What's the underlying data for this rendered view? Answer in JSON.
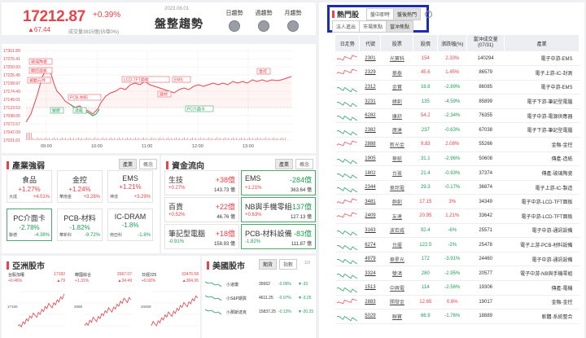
{
  "header": {
    "price": "17212.87",
    "pct": "+0.39%",
    "change": "▲67.44",
    "volume": "成交量3815億(佔增0%)",
    "date": "2023.08.01",
    "trend": "盤整趨勢",
    "buttons": [
      "日趨勢",
      "週趨勢",
      "月趨勢"
    ]
  },
  "intraday": {
    "y_ticks": [
      "17301.89",
      "17276.41",
      "17250.93",
      "17225.45",
      "17199.97",
      "17174.49",
      "17149.01",
      "17123.53",
      "17098.05",
      "17072.57",
      "17047.09",
      "17021.61"
    ],
    "x_ticks": [
      "09:00",
      "10:00",
      "11:00",
      "12:00",
      "13:00"
    ],
    "annotations": [
      "玻璃陶瓷",
      "觸控面板",
      "LCD-TFT面板",
      "EMS",
      "金控",
      "被動元件",
      "PCB-材料",
      "建材",
      "PC介面卡",
      "造紙",
      "塑膠"
    ],
    "prev_close": 17145.43
  },
  "sectors": {
    "title": "產業強弱",
    "tabs": [
      "產業",
      "概念"
    ],
    "cards": [
      {
        "name": "食品",
        "pct": "+1.27%",
        "sub": "大成",
        "subpct": "+4.01%"
      },
      {
        "name": "金控",
        "pct": "+1.24%",
        "sub": "華南金",
        "subpct": "+3.28%"
      },
      {
        "name": "EMS",
        "pct": "+1.21%",
        "sub": "神達",
        "subpct": "+3.29%"
      },
      {
        "name": "PC介面卡",
        "pct": "-2.78%",
        "sub": "聯德",
        "subpct": "-4.38%"
      },
      {
        "name": "PCB-材料",
        "pct": "-1.82%",
        "sub": "華新科",
        "subpct": "-9.72%"
      },
      {
        "name": "IC-DRAM",
        "pct": "-1.8%",
        "sub": "南亞科",
        "subpct": "-1.8%"
      }
    ]
  },
  "fund_flow": {
    "title": "資金流向",
    "tabs": [
      "產業",
      "概念"
    ],
    "cards": [
      {
        "name": "生技",
        "value": "+38億",
        "pct": "+0.27%",
        "amount": "143.73 億"
      },
      {
        "name": "EMS",
        "value": "-284億",
        "pct": "+1.21%",
        "amount": "363.64 億"
      },
      {
        "name": "百貨",
        "value": "+22億",
        "pct": "+0.52%",
        "amount": "46.76 億"
      },
      {
        "name": "NB與手機零組",
        "value": "-137億",
        "pct": "+0.63%",
        "amount": "127.13 億"
      },
      {
        "name": "筆記型電腦",
        "value": "+18億",
        "pct": "-0.91%",
        "amount": "158.93 億"
      },
      {
        "name": "PCB-材料設備",
        "value": "-83億",
        "pct": "-1.82%",
        "amount": "111.87 億"
      }
    ]
  },
  "asia": {
    "title": "亞洲股市",
    "minis": [
      {
        "name": "台股加權",
        "value": "17182",
        "pct": "+0.46%",
        "chg": "▲79"
      },
      {
        "name": "韓國綜合",
        "value": "2667.07",
        "pct": "+1.31%",
        "chg": "▲34.49"
      },
      {
        "name": "日經225",
        "value": "33476.58",
        "pct": "+0.92%",
        "chg": "▲304.36"
      }
    ],
    "mini_ticks": [
      "17160",
      "2668",
      "33469"
    ]
  },
  "us": {
    "title": "美國股市",
    "tabs": [
      "期貨",
      "指數"
    ],
    "page": "1/3",
    "rows": [
      {
        "name": "小道瓊",
        "value": "35662",
        "pct": "-0.09%",
        "chg": "▼-33"
      },
      {
        "name": "小S&P期貨",
        "value": "4611.25",
        "pct": "-0.07%",
        "chg": "▼-3.25"
      },
      {
        "name": "小那斯達克",
        "value": "15837.25",
        "pct": "-0.13%",
        "chg": "▼-20.25"
      }
    ]
  },
  "hot": {
    "title": "熱門股",
    "tabs1": [
      "盤中即時",
      "盤後熱門"
    ],
    "tabs2": [
      "法人進出",
      "市場焦點",
      "當沖焦點"
    ],
    "help": "?",
    "columns": [
      "日走勢",
      "代號",
      "股票",
      "股價",
      "漲跌幅(%)",
      "當沖成交量\n(07/31)",
      "產業"
    ],
    "rows": [
      {
        "code": "2301",
        "name": "光寶科",
        "price": "154",
        "pct": "2.33%",
        "vol": "140294",
        "ind": "電子中游-EMS",
        "up": true
      },
      {
        "code": "2329",
        "name": "華泰",
        "price": "45.6",
        "pct": "1.45%",
        "vol": "86579",
        "ind": "電子上游-IC-封測",
        "up": true
      },
      {
        "code": "2312",
        "name": "金寶",
        "price": "16.8",
        "pct": "-2.89%",
        "vol": "86085",
        "ind": "電子中游-EMS",
        "up": false
      },
      {
        "code": "3231",
        "name": "緯創",
        "price": "135",
        "pct": "-4.59%",
        "vol": "85899",
        "ind": "電子下游-筆記型電腦",
        "up": false
      },
      {
        "code": "6282",
        "name": "康舒",
        "price": "54.2",
        "price_up": true,
        "pct": "-2.34%",
        "vol": "76355",
        "ind": "電子中游-電源供應器",
        "up": false
      },
      {
        "code": "2382",
        "name": "廣達",
        "price": "237",
        "pct": "-0.63%",
        "vol": "67038",
        "ind": "電子下游-筆記型電腦",
        "up": false
      },
      {
        "code": "2888",
        "name": "新光金",
        "price": "9.83",
        "pct": "2.08%",
        "vol": "55266",
        "ind": "金融-金控",
        "up": true
      },
      {
        "code": "1905",
        "name": "華紙",
        "price": "31.1",
        "pct": "-2.96%",
        "vol": "50608",
        "ind": "傳產-造紙",
        "up": false
      },
      {
        "code": "1802",
        "name": "台玻",
        "price": "21.4",
        "pct": "-0.93%",
        "vol": "37374",
        "ind": "傳產-玻璃陶瓷",
        "up": false
      },
      {
        "code": "2344",
        "name": "華邦電",
        "price": "29.3",
        "pct": "-0.17%",
        "vol": "36874",
        "ind": "電子上游-IC-製造",
        "up": false
      },
      {
        "code": "3481",
        "name": "群創",
        "price": "17.15",
        "pct": "3%",
        "vol": "34349",
        "ind": "電子中游-LCD-TFT面板",
        "up": true
      },
      {
        "code": "2409",
        "name": "友達",
        "price": "20.95",
        "pct": "1.21%",
        "vol": "33642",
        "ind": "電子中游-LCD-TFT面板",
        "up": true
      },
      {
        "code": "3163",
        "name": "波若威",
        "price": "92.4",
        "pct": "-6%",
        "vol": "25571",
        "ind": "電子中游-通訊設備",
        "up": false
      },
      {
        "code": "6274",
        "name": "台燿",
        "price": "122.5",
        "pct": "-2%",
        "vol": "25478",
        "ind": "電子上游-PCB-材料設備",
        "up": false
      },
      {
        "code": "4979",
        "name": "華星光",
        "price": "172",
        "pct": "-3.91%",
        "vol": "24460",
        "ind": "電子中游-通訊設備",
        "up": false
      },
      {
        "code": "3324",
        "name": "雙鴻",
        "price": "280",
        "pct": "-2.95%",
        "vol": "20577",
        "ind": "電子中游-NB與手機零組",
        "up": false
      },
      {
        "code": "1513",
        "name": "中興電",
        "price": "114",
        "pct": "-2.56%",
        "vol": "19306",
        "ind": "傳產-電機",
        "up": false
      },
      {
        "code": "2883",
        "name": "開發金",
        "price": "12.65",
        "pct": "0.8%",
        "vol": "19017",
        "ind": "金融-金控",
        "up": true
      },
      {
        "code": "5029",
        "name": "聯寶",
        "price": "66.9",
        "pct": "-1.76%",
        "vol": "18889",
        "ind": "軟體-系統整合",
        "up": false
      }
    ]
  },
  "colors": {
    "up": "#e8424a",
    "down": "#1f9d55",
    "highlight": "#1b2bb5"
  }
}
